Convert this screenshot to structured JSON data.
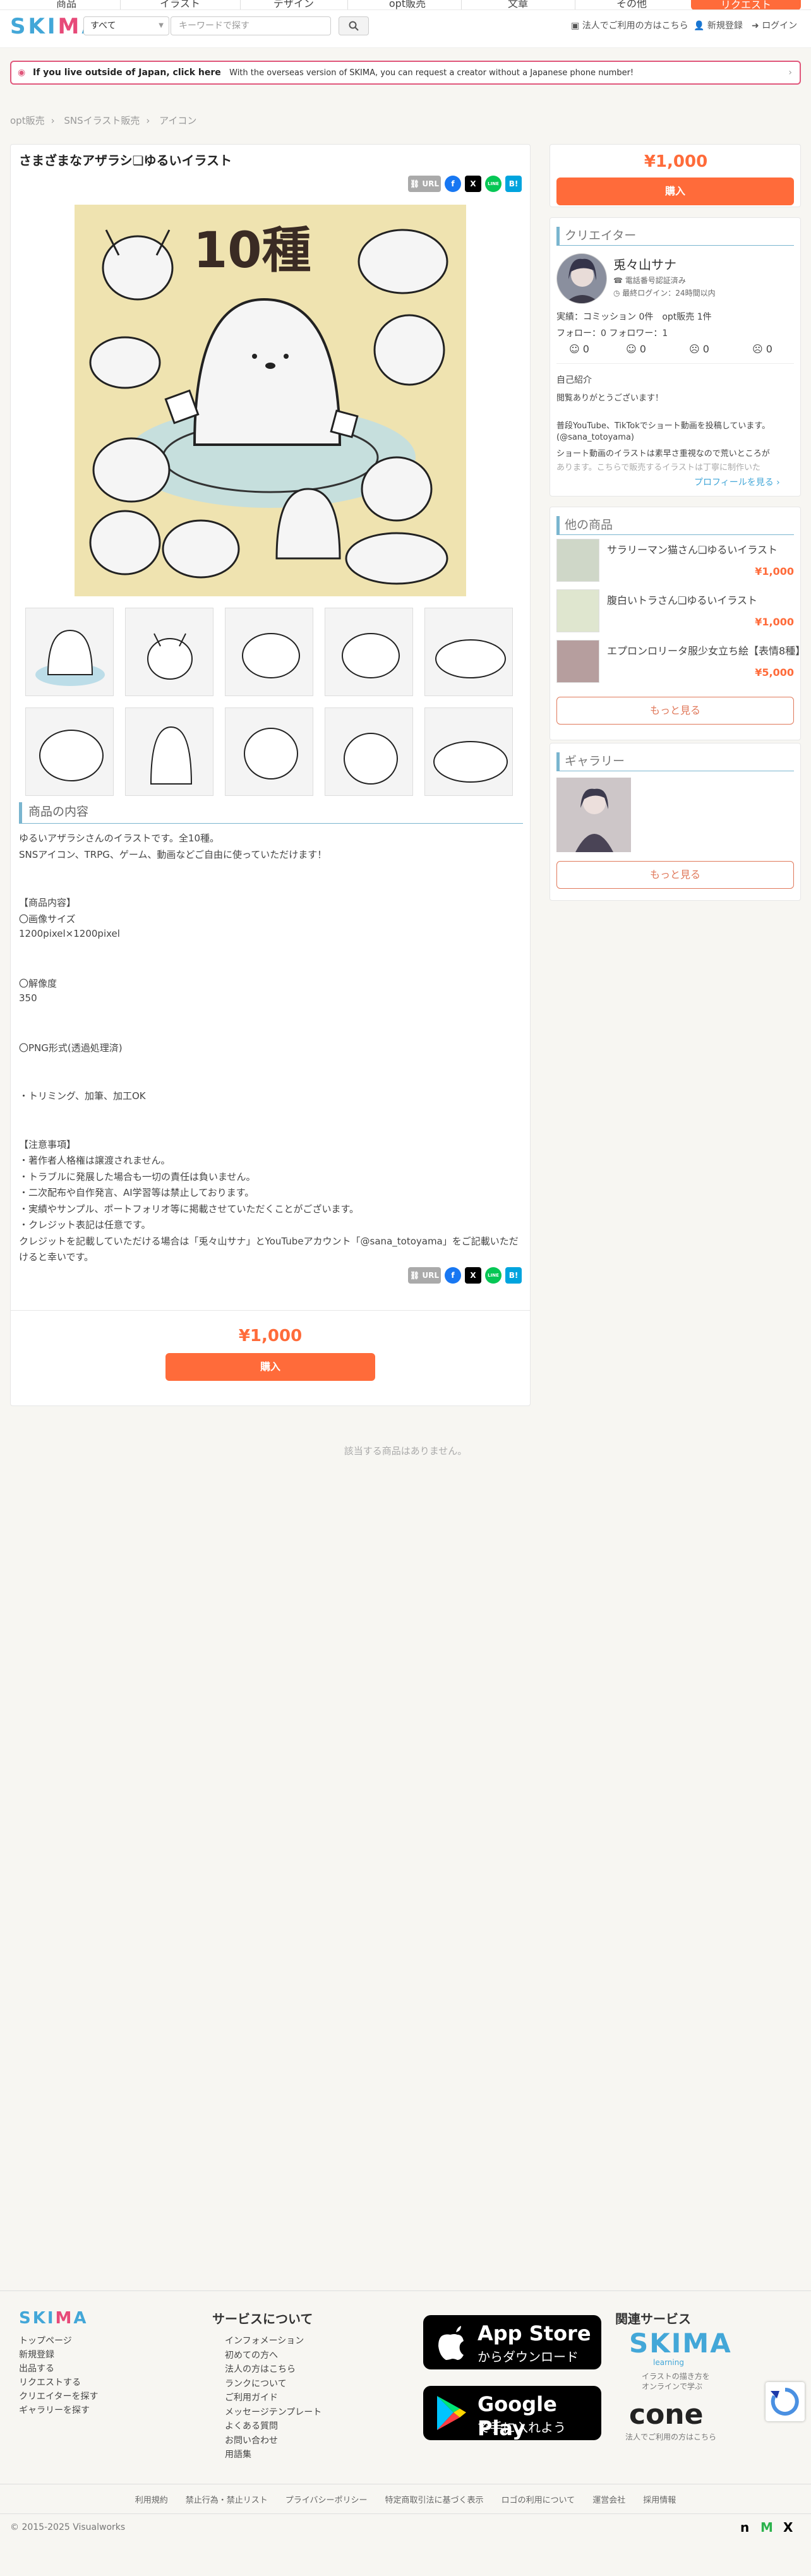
{
  "topnav": {
    "items": [
      "商品",
      "イラスト",
      "デザイン",
      "opt販売",
      "文章",
      "その他"
    ],
    "request_button": "リクエスト"
  },
  "header": {
    "logo": "SKIMA",
    "category": "すべて",
    "search_placeholder": "キーワードで探す",
    "links": [
      "法人でご利用の方はこちら",
      "新規登録",
      "ログイン"
    ]
  },
  "banner": {
    "bold": "If you live outside of Japan, click here",
    "text": "With the overseas version of SKIMA, you can request a creator without a Japanese phone number!"
  },
  "breadcrumb": [
    "opt販売",
    "SNSイラスト販売",
    "アイコン"
  ],
  "product": {
    "title": "さまざまなアザラシ❏ゆるいイラスト",
    "image_label": "10種",
    "share": {
      "url": "URL",
      "fb": "f",
      "x": "X",
      "line": "LINE",
      "hatena": "B!"
    },
    "section_title": "商品の内容",
    "description": [
      "ゆるいアザラシさんのイラストです。全10種。",
      "SNSアイコン、TRPG、ゲーム、動画などご自由に使っていただけます！",
      "",
      "",
      "【商品内容】",
      "〇画像サイズ",
      "1200pixel×1200pixel",
      "",
      "",
      "〇解像度",
      "350",
      "",
      "",
      "〇PNG形式(透過処理済)",
      "",
      "",
      "・トリミング、加筆、加工OK",
      "",
      "",
      "【注意事項】",
      "・著作者人格権は譲渡されません。",
      "・トラブルに発展した場合も一切の責任は負いません。",
      "・二次配布や自作発言、AI学習等は禁止しております。",
      "・実績やサンプル、ポートフォリオ等に掲載させていただくことがございます。",
      "・クレジット表記は任意です。",
      "クレジットを記載していただける場合は「兎々山サナ」とYouTubeアカウント「@sana_totoyama」をご記載いただ",
      "けると幸いです。"
    ],
    "price": "¥1,000",
    "buy_label": "購入",
    "related_empty": "該当する商品はありません。"
  },
  "sidebar": {
    "price": "¥1,000",
    "buy_label": "購入",
    "creator_title": "クリエイター",
    "creator_name": "兎々山サナ",
    "verified": "電話番号認証済み",
    "last_login": "最終ログイン：24時間以内",
    "stats": "実績：コミッション 0件　opt販売 1件",
    "follow": "フォロー：0 フォロワー：1",
    "ratings": [
      "0",
      "0",
      "0",
      "0"
    ],
    "intro_title": "自己紹介",
    "intro": [
      "閲覧ありがとうございます！",
      "",
      "普段YouTube、TikTokでショート動画を投稿しています。",
      "(@sana_totoyama)",
      "ショート動画のイラストは素早さ重視なので荒いところが",
      "あります。こちらで販売するイラストは丁寧に制作いた"
    ],
    "profile_link": "プロフィールを見る ›",
    "other_title": "他の商品",
    "others": [
      {
        "name": "サラリーマン猫さん❏ゆるいイラスト",
        "price": "¥1,000"
      },
      {
        "name": "腹白いトラさん❏ゆるいイラスト",
        "price": "¥1,000"
      },
      {
        "name": "エプロンロリータ服少女立ち絵【表情8種】",
        "price": "¥5,000"
      }
    ],
    "more_label": "もっと見る",
    "gallery_title": "ギャラリー",
    "gallery_more": "もっと見る"
  },
  "footer": {
    "logo": "SKIMA",
    "col1": [
      "トップページ",
      "新規登録",
      "出品する",
      "リクエストする",
      "クリエイターを探す",
      "ギャラリーを探す"
    ],
    "about_title": "サービスについて",
    "col2": [
      "インフォメーション",
      "初めての方へ",
      "法人の方はこちら",
      "ランクについて",
      "ご利用ガイド",
      "メッセージテンプレート",
      "よくある質問",
      "お問い合わせ",
      "用語集"
    ],
    "appstore": {
      "top": "App Store",
      "bottom": "からダウンロード"
    },
    "googleplay": {
      "top": "Google Play",
      "bottom": "で手に入れよう"
    },
    "related_title": "関連サービス",
    "learning_logo": "SKIMA",
    "learning_sub": "learning",
    "learning_desc": [
      "イラストの描き方を",
      "オンラインで学ぶ"
    ],
    "cone_logo": "cone",
    "cone_desc": "法人でご利用の方はこちら",
    "bottom_links": [
      "利用規約",
      "禁止行為・禁止リスト",
      "プライバシーポリシー",
      "特定商取引法に基づく表示",
      "ロゴの利用について",
      "運営会社",
      "採用情報"
    ],
    "copyright": "© 2015-2025 Visualworks"
  },
  "colors": {
    "accent": "#ff6b3a",
    "section": "#7ab5cf",
    "banner": "#e0577b",
    "logo_blue": "#43a7d8"
  }
}
